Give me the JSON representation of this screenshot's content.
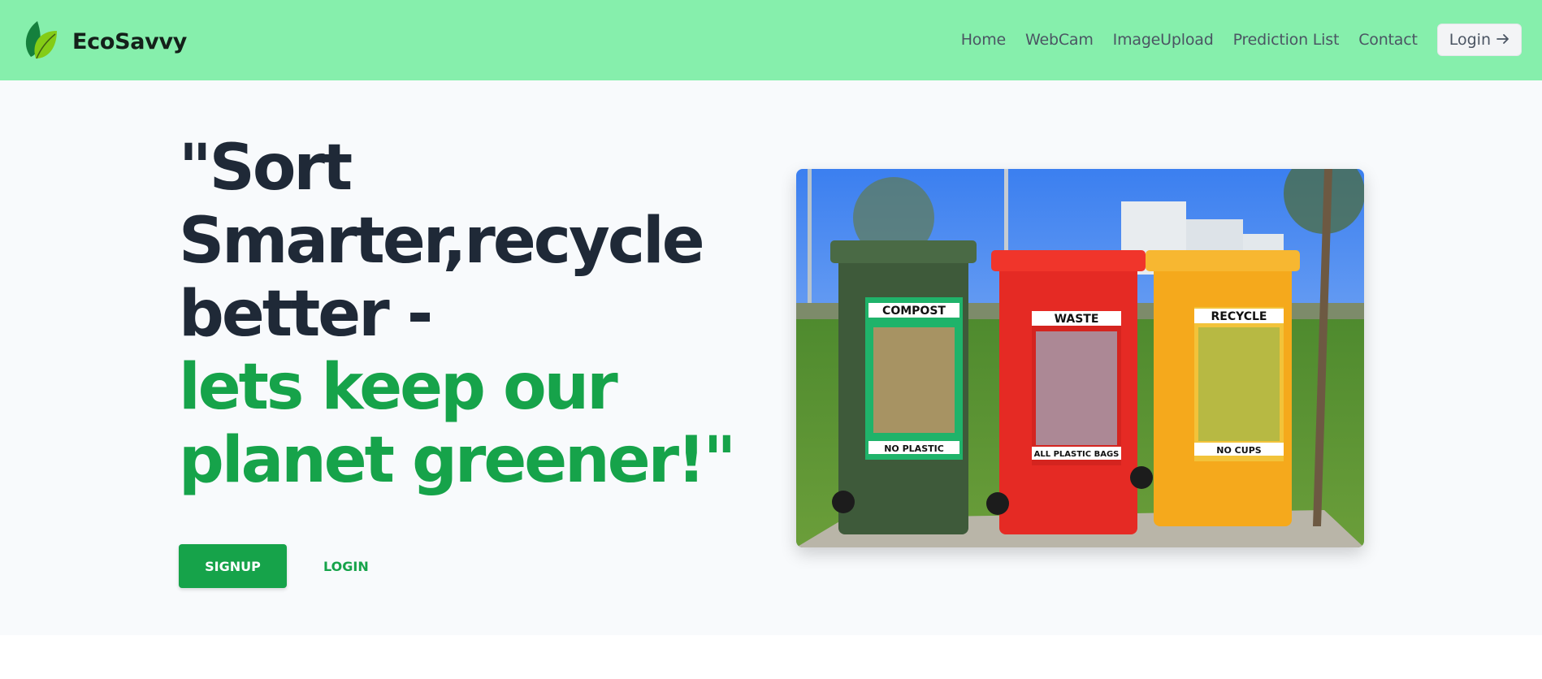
{
  "brand": {
    "name": "EcoSavvy",
    "icon": "leaf-icon"
  },
  "nav": {
    "items": [
      {
        "label": "Home"
      },
      {
        "label": "WebCam"
      },
      {
        "label": "ImageUpload"
      },
      {
        "label": "Prediction List"
      },
      {
        "label": "Contact"
      }
    ],
    "login_label": "Login",
    "login_icon": "arrow-right-icon"
  },
  "hero": {
    "line1": "\"Sort",
    "line2": "Smarter,recycle",
    "line3": "better -",
    "line4": "lets keep our",
    "line5": "planet greener!\"",
    "signup_label": "SIGNUP",
    "login_label": "LOGIN"
  },
  "image": {
    "bins": [
      {
        "label": "COMPOST",
        "bottom_label": "NO PLASTIC"
      },
      {
        "label": "WASTE",
        "bottom_label": "ALL PLASTIC BAGS"
      },
      {
        "label": "RECYCLE",
        "bottom_label": "NO CUPS"
      }
    ]
  },
  "colors": {
    "navbar": "#86efac",
    "accent": "#16a34a",
    "text_dark": "#1f2937",
    "hero_bg": "#f8fafc"
  }
}
